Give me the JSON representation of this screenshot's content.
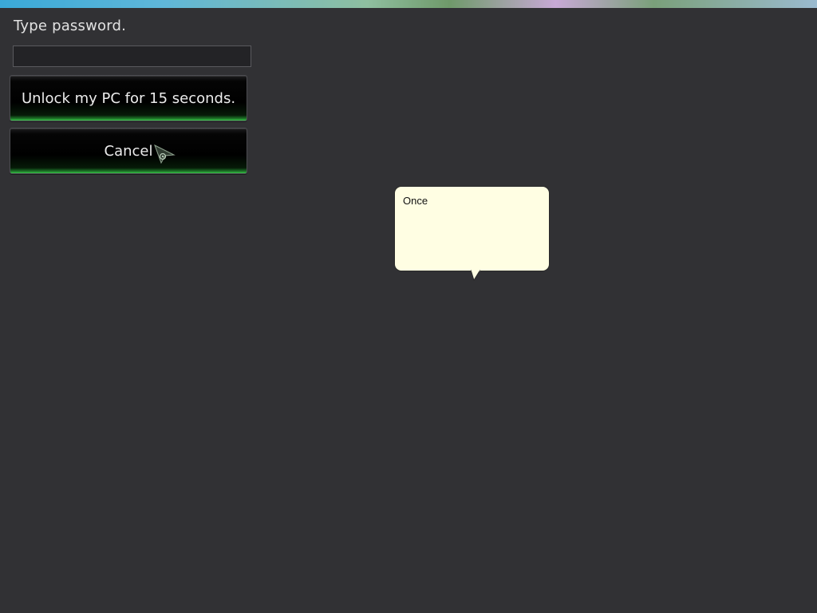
{
  "lock_screen": {
    "prompt": "Type password.",
    "password_value": "",
    "unlock_label": "Unlock my PC for 15 seconds.",
    "cancel_label": "Cancel"
  },
  "tooltip": {
    "text": "Once"
  },
  "colors": {
    "background": "#313134",
    "button_glow": "#39c449",
    "tooltip_bg": "#fffee3"
  },
  "icons": [
    "mouse-pointer-icon"
  ]
}
